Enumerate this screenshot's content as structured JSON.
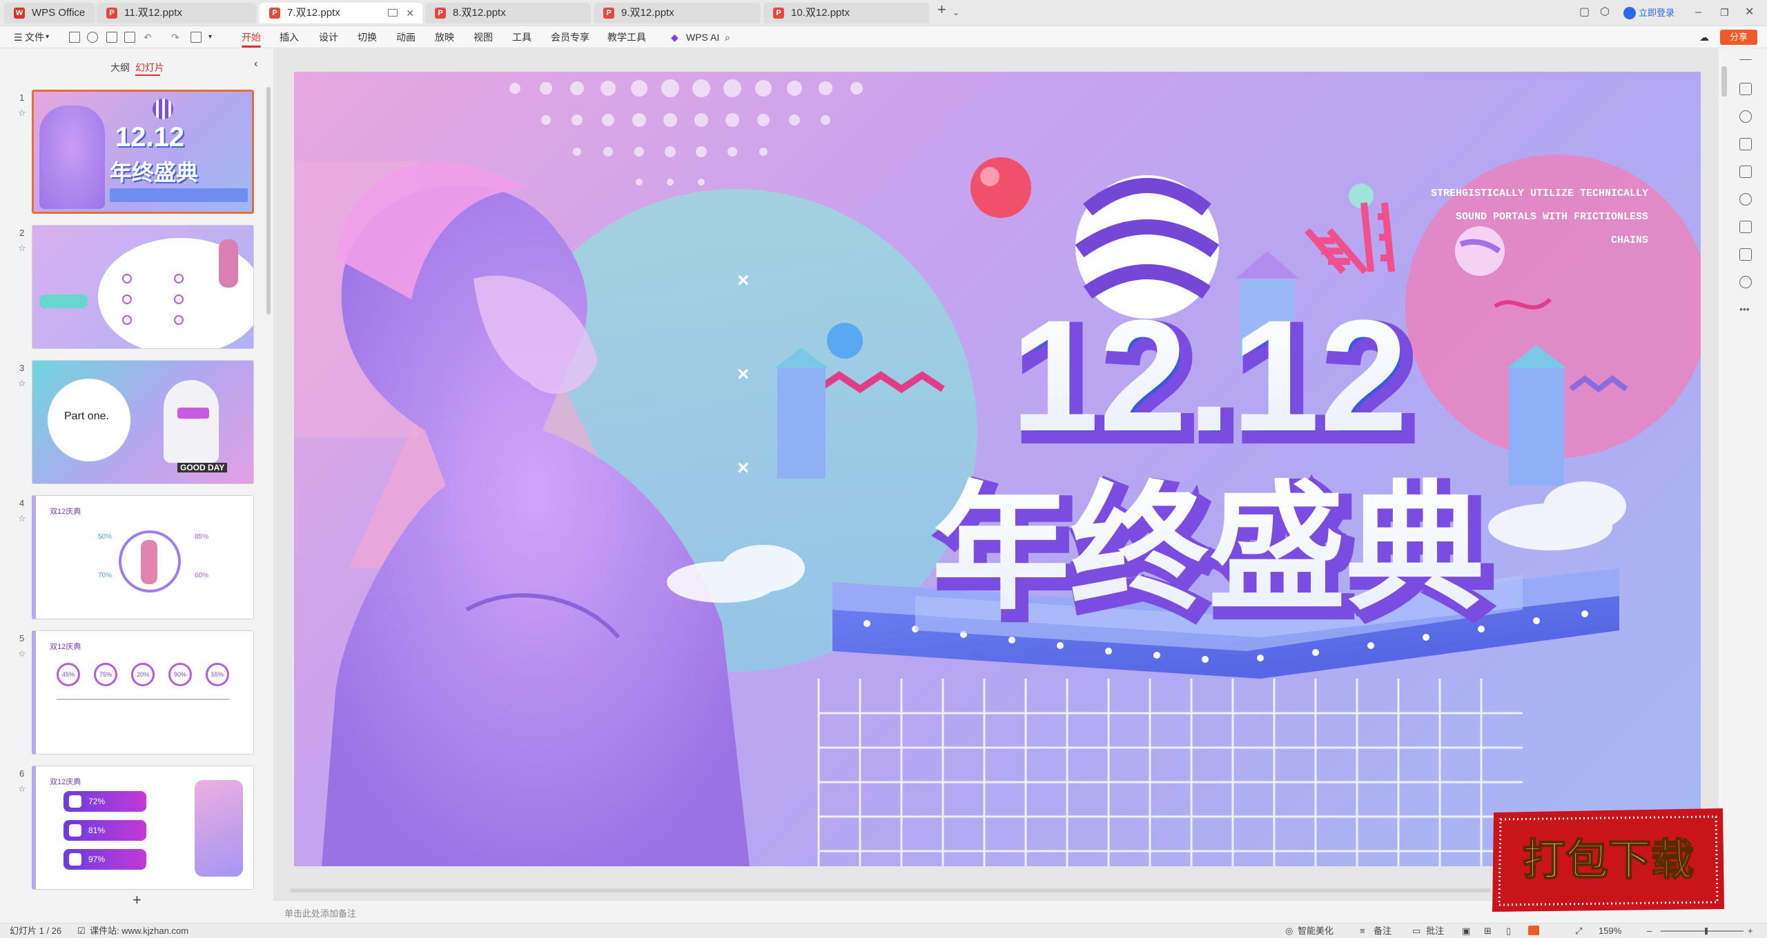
{
  "tabs": [
    {
      "label": "WPS Office",
      "icon": "wps-logo-icon"
    },
    {
      "label": "11.双12.pptx",
      "icon": "ppt-file-icon"
    },
    {
      "label": "7.双12.pptx",
      "icon": "ppt-file-icon",
      "active": true
    },
    {
      "label": "8.双12.pptx",
      "icon": "ppt-file-icon"
    },
    {
      "label": "9.双12.pptx",
      "icon": "ppt-file-icon"
    },
    {
      "label": "10.双12.pptx",
      "icon": "ppt-file-icon"
    }
  ],
  "window": {
    "login_label": "立即登录",
    "add_tab": "+"
  },
  "menu": {
    "file_label": "文件",
    "items": [
      "开始",
      "插入",
      "设计",
      "切换",
      "动画",
      "放映",
      "视图",
      "工具",
      "会员专享",
      "教学工具"
    ],
    "active_item": "开始",
    "ai_label": "WPS AI",
    "share_label": "分享"
  },
  "pane": {
    "tab_outline": "大纲",
    "tab_slides": "幻灯片",
    "add_slide": "+"
  },
  "thumbnails": [
    {
      "num": "1",
      "title": "12.12",
      "subtitle": "年终盛典"
    },
    {
      "num": "2"
    },
    {
      "num": "3",
      "part_label": "Part one.",
      "tag": "GOOD DAY"
    },
    {
      "num": "4",
      "header": "双12庆典",
      "percents": [
        "50%",
        "85%",
        "70%",
        "60%"
      ]
    },
    {
      "num": "5",
      "header": "双12庆典",
      "percents": [
        "45%",
        "75%",
        "20%",
        "90%",
        "55%"
      ]
    },
    {
      "num": "6",
      "header": "双12庆典",
      "pills": [
        "72%",
        "81%",
        "97%"
      ]
    }
  ],
  "slide": {
    "big_number": "12.12",
    "big_title": "年终盛典",
    "english_lines": [
      "STREHGISTICALLY UTILIZE TECHNICALLY",
      "SOUND PORTALS WITH FRICTIONLESS",
      "CHAINS"
    ],
    "x_marks": [
      "×",
      "×",
      "×"
    ]
  },
  "notes_placeholder": "单击此处添加备注",
  "status": {
    "slide_indicator": "幻灯片 1 / 26",
    "site_label": "课件站: www.kjzhan.com",
    "beautify": "智能美化",
    "notes": "备注",
    "comments": "批注",
    "zoom": "159%"
  },
  "stamp": {
    "text": "打包下载"
  },
  "colors": {
    "accent": "#d8332a",
    "share": "#ef5a28",
    "selected_border": "#e46f3a"
  }
}
